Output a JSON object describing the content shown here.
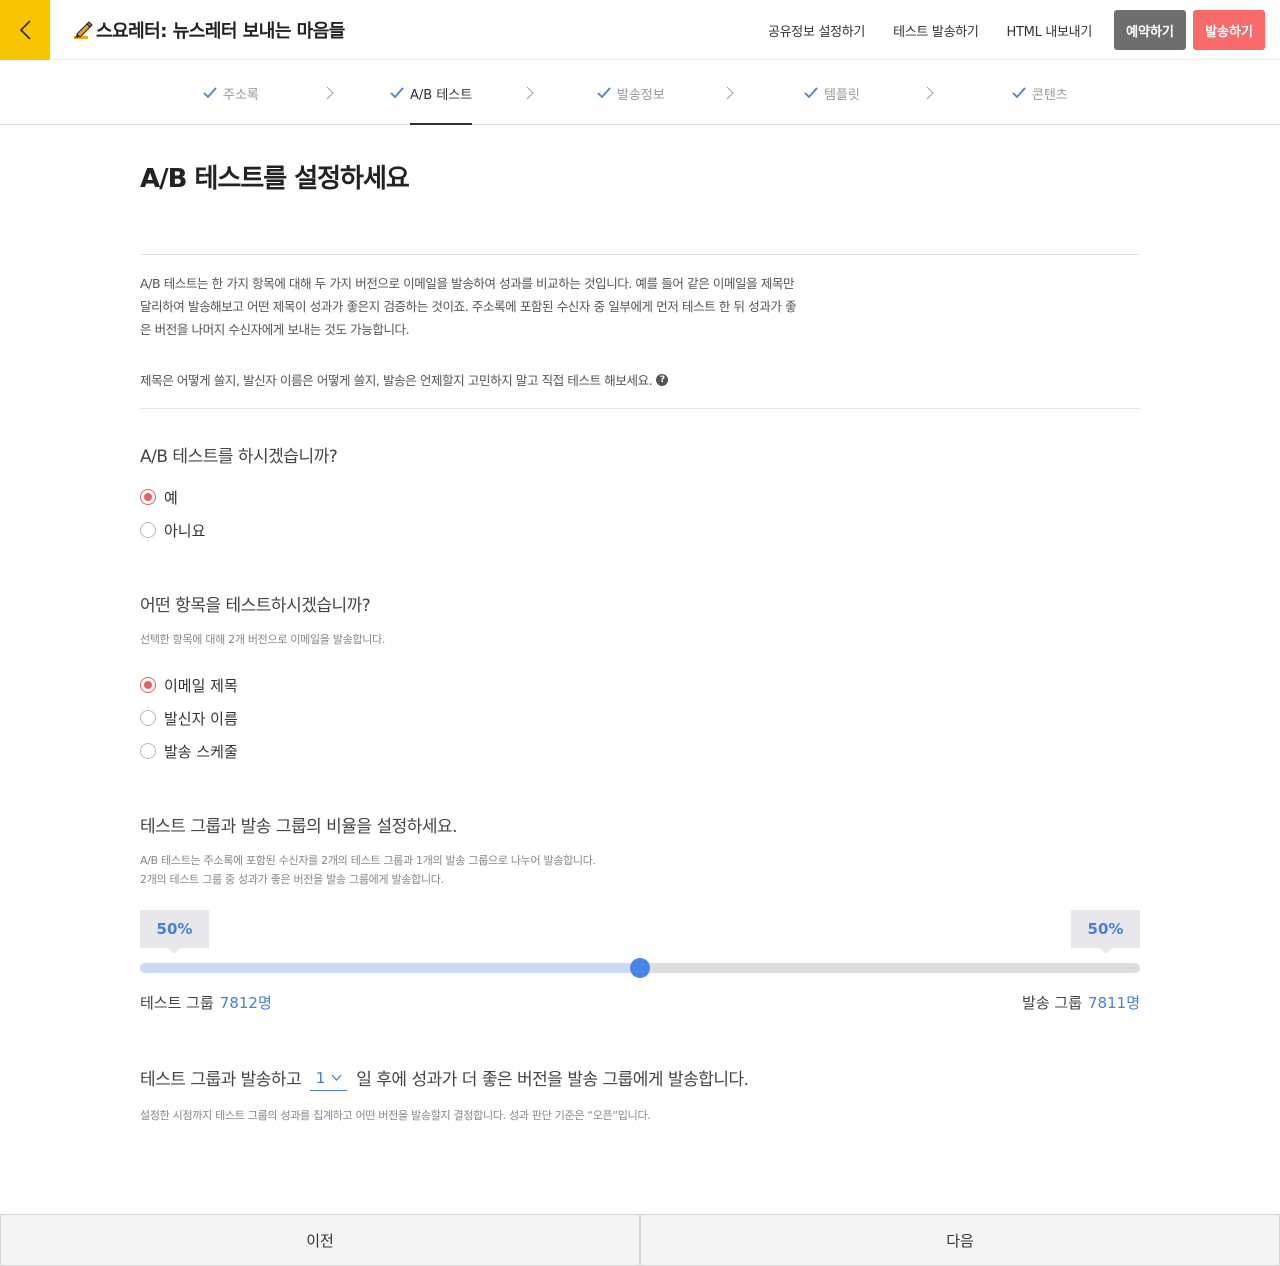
{
  "header": {
    "title": "스요레터: 뉴스레터 보내는 마음들",
    "menu": [
      "공유정보 설정하기",
      "테스트 발송하기",
      "HTML 내보내기"
    ],
    "reserve_label": "예약하기",
    "send_label": "발송하기"
  },
  "steps": [
    {
      "label": "주소록",
      "done": true,
      "active": false
    },
    {
      "label": "A/B 테스트",
      "done": true,
      "active": true
    },
    {
      "label": "발송정보",
      "done": true,
      "active": false
    },
    {
      "label": "템플릿",
      "done": true,
      "active": false
    },
    {
      "label": "콘텐츠",
      "done": true,
      "active": false
    }
  ],
  "main": {
    "page_title": "A/B 테스트를 설정하세요",
    "intro": "A/B 테스트는 한 가지 항목에 대해 두 가지 버전으로 이메일을 발송하여 성과를 비교하는 것입니다. 예를 들어 같은 이메일을 제목만 달리하여 발송해보고 어떤 제목이 성과가 좋은지 검증하는 것이죠. 주소록에 포함된 수신자 중 일부에게 먼저 테스트 한 뒤 성과가 좋은 버전을 나머지 수신자에게 보내는 것도 가능합니다.",
    "intro2": "제목은 어떻게 쓸지, 발신자 이름은 어떻게 쓸지, 발송은 언제할지 고민하지 말고 직접 테스트 해보세요.",
    "help_glyph": "?",
    "q1": {
      "title": "A/B 테스트를 하시겠습니까?",
      "options": [
        "예",
        "아니요"
      ],
      "selected": 0
    },
    "q2": {
      "title": "어떤 항목을 테스트하시겠습니까?",
      "desc": "선택한 항목에 대해 2개 버전으로 이메일을 발송합니다.",
      "options": [
        "이메일 제목",
        "발신자 이름",
        "발송 스케줄"
      ],
      "selected": 0
    },
    "q3": {
      "title": "테스트 그룹과 발송 그룹의 비율을 설정하세요.",
      "desc1": "A/B 테스트는 주소록에 포함된 수신자를 2개의 테스트 그룹과 1개의 발송 그룹으로 나누어 발송합니다.",
      "desc2": "2개의 테스트 그룹 중 성과가 좋은 버전을 발송 그룹에게 발송합니다.",
      "test_pct": "50%",
      "send_pct": "50%",
      "ratio": 0.5,
      "test_group_label": "테스트 그룹",
      "test_group_count": "7812명",
      "send_group_label": "발송 그룹",
      "send_group_count": "7811명"
    },
    "q4": {
      "prefix": "테스트 그룹과 발송하고",
      "day_value": "1",
      "suffix": "일 후에 성과가 더 좋은 버전을 발송 그룹에게 발송합니다.",
      "desc": "설정한 시점까지 테스트 그룹의 성과를 집계하고 어떤 버전을 발송할지 결정합니다. 성과 판단 기준은 “오픈”입니다."
    }
  },
  "footer": {
    "prev_label": "이전",
    "next_label": "다음"
  },
  "colors": {
    "brand_yellow": "#f7c600",
    "accent_red": "#f96a6a",
    "accent_blue": "#4a86e8",
    "radio_red": "#e96060"
  }
}
